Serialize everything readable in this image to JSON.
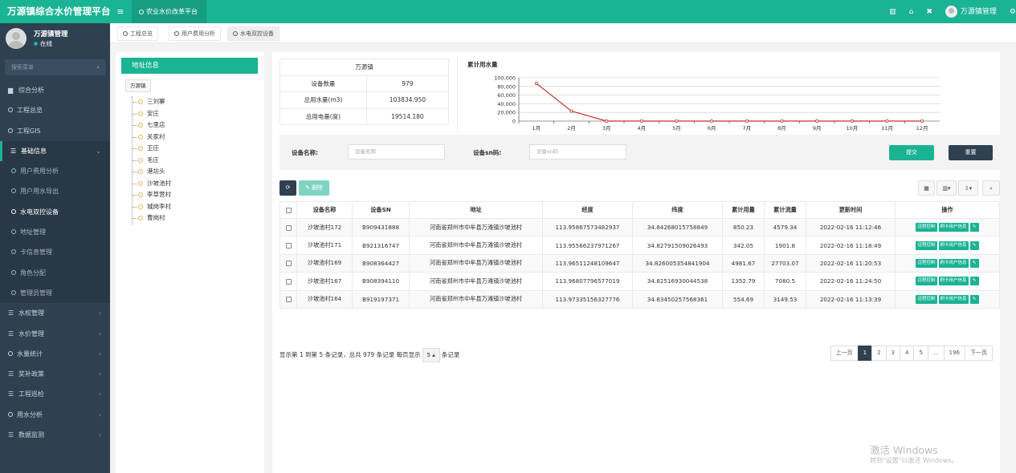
{
  "app": {
    "title": "万源镇综合水价管理平台",
    "top_tab": "农业水价改革平台",
    "user": "万源镇管理"
  },
  "sidebar": {
    "user_name": "万源镇管理",
    "status": "在线",
    "search_placeholder": "搜索菜单",
    "items": [
      {
        "label": "综合分析",
        "icon": "chart-icon",
        "type": "top"
      },
      {
        "label": "工程总览",
        "type": "circle"
      },
      {
        "label": "工程GIS",
        "type": "circle"
      },
      {
        "label": "基础信息",
        "icon": "list-icon",
        "type": "open",
        "arrow": "⌄"
      },
      {
        "label": "用户费用分析",
        "type": "sub"
      },
      {
        "label": "用户用水导出",
        "type": "sub"
      },
      {
        "label": "水电双控设备",
        "type": "sub-active"
      },
      {
        "label": "地址管理",
        "type": "sub"
      },
      {
        "label": "卡信息管理",
        "type": "sub"
      },
      {
        "label": "角色分配",
        "type": "sub"
      },
      {
        "label": "管理员管理",
        "type": "sub"
      },
      {
        "label": "水权管理",
        "icon": "list-icon",
        "type": "top",
        "arrow": "‹"
      },
      {
        "label": "水价管理",
        "icon": "list-icon",
        "type": "top",
        "arrow": "‹"
      },
      {
        "label": "水量统计",
        "type": "circle",
        "arrow": "‹"
      },
      {
        "label": "奖补政策",
        "icon": "list-icon",
        "type": "top",
        "arrow": "‹"
      },
      {
        "label": "工程巡检",
        "icon": "list-icon",
        "type": "top",
        "arrow": "‹"
      },
      {
        "label": "用水分析",
        "type": "circle",
        "arrow": "‹"
      },
      {
        "label": "数据监测",
        "icon": "list-icon",
        "type": "top",
        "arrow": "‹"
      }
    ]
  },
  "tabs": [
    "工程总览",
    "用户费用分析",
    "水电双控设备"
  ],
  "address": {
    "title": "地址信息",
    "root": "万源镇",
    "villages": [
      "三刘寨",
      "安庄",
      "七里店",
      "关家村",
      "王庄",
      "毛庄",
      "港坊头",
      "沙坡池村",
      "李草营村",
      "城岗李村",
      "曹岗村"
    ]
  },
  "summary": {
    "header": "万源镇",
    "rows": [
      {
        "label": "设备数量",
        "value": "979"
      },
      {
        "label": "总用水量(m3)",
        "value": "103834.950"
      },
      {
        "label": "总用电量(度)",
        "value": "19514.180"
      }
    ]
  },
  "chart_data": {
    "type": "line",
    "title": "累计用水量",
    "categories": [
      "1月",
      "2月",
      "3月",
      "4月",
      "5月",
      "6月",
      "7月",
      "8月",
      "9月",
      "10月",
      "11月",
      "12月"
    ],
    "values": [
      87000,
      23000,
      0,
      0,
      0,
      0,
      0,
      0,
      0,
      0,
      0,
      0
    ],
    "yticks": [
      "0",
      "20,000",
      "40,000",
      "60,000",
      "80,000",
      "100,000"
    ],
    "ylim": [
      0,
      100000
    ],
    "grid": true,
    "color": "#c23531"
  },
  "filter": {
    "name_label": "设备名称:",
    "name_placeholder": "设备名称",
    "sn_label": "设备sn码:",
    "sn_placeholder": "设备sn码",
    "submit": "提交",
    "reset": "重置"
  },
  "toolbar": {
    "delete": "删除"
  },
  "table": {
    "headers": [
      "设备名称",
      "设备SN",
      "地址",
      "经度",
      "纬度",
      "累计用量",
      "累计流量",
      "更新时间",
      "操作"
    ],
    "rows": [
      [
        "沙坡池村172",
        "B909431888",
        "河南省郑州市中牟县万滩镇沙坡池村",
        "113.95867573482937",
        "34.84268015758849",
        "850.23",
        "4579.34",
        "2022-02-16 11:12:46"
      ],
      [
        "沙坡池村171",
        "B921316747",
        "河南省郑州市中牟县万滩镇沙坡池村",
        "113.95566237971267",
        "34.82791509026493",
        "342.05",
        "1901.8",
        "2022-02-16 11:18:49"
      ],
      [
        "沙坡池村169",
        "B908364427",
        "河南省郑州市中牟县万滩镇沙坡池村",
        "113.96511248109647",
        "34.826005354841904",
        "4981.67",
        "27703.07",
        "2022-02-16 11:20:53"
      ],
      [
        "沙坡池村167",
        "B908394110",
        "河南省郑州市中牟县万滩镇沙坡池村",
        "113.96807796577019",
        "34.82516930044538",
        "1352.79",
        "7080.5",
        "2022-02-16 11:24:50"
      ],
      [
        "沙坡池村164",
        "B919197371",
        "河南省郑州市中牟县万滩镇沙坡池村",
        "113.97335156327776",
        "34.83450257568361",
        "554.69",
        "3149.53",
        "2022-02-16 11:13:39"
      ]
    ],
    "op_remote": "远程控制",
    "op_bind": "刷卡用户信息"
  },
  "footer": {
    "info": "显示第 1 到第 5 条记录，总共 979 条记录 每页显示",
    "per_page": "5 ▴",
    "suffix": "条记录"
  },
  "pager": [
    "上一页",
    "1",
    "2",
    "3",
    "4",
    "5",
    "...",
    "196",
    "下一页"
  ],
  "watermark": {
    "line1": "激活 Windows",
    "line2": "转到\"设置\"以激活 Windows。"
  }
}
